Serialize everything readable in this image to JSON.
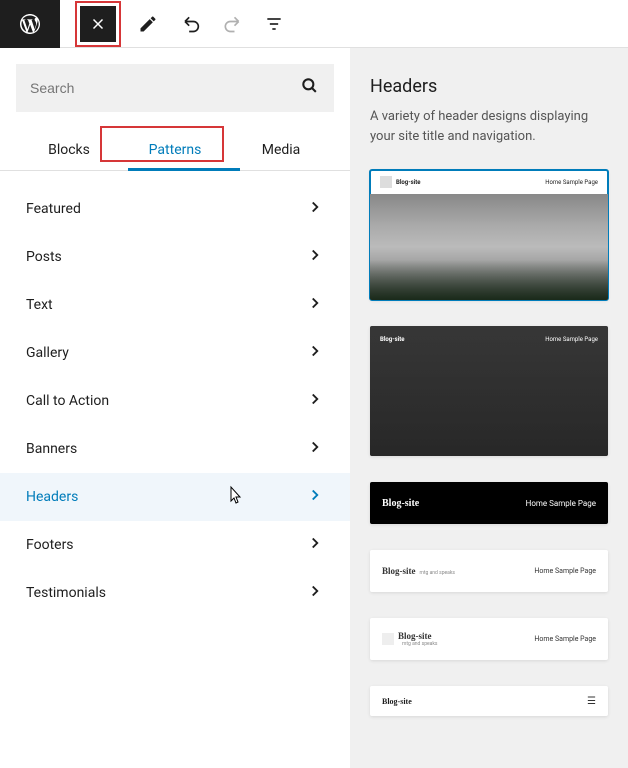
{
  "search": {
    "placeholder": "Search"
  },
  "tabs": {
    "blocks": "Blocks",
    "patterns": "Patterns",
    "media": "Media"
  },
  "categories": [
    {
      "label": "Featured",
      "active": false
    },
    {
      "label": "Posts",
      "active": false
    },
    {
      "label": "Text",
      "active": false
    },
    {
      "label": "Gallery",
      "active": false
    },
    {
      "label": "Call to Action",
      "active": false
    },
    {
      "label": "Banners",
      "active": false
    },
    {
      "label": "Headers",
      "active": true
    },
    {
      "label": "Footers",
      "active": false
    },
    {
      "label": "Testimonials",
      "active": false
    }
  ],
  "rightPanel": {
    "title": "Headers",
    "description": "A variety of header designs displaying your site title and navigation."
  },
  "previews": {
    "siteTitle": "Blog-site",
    "nav": "Home   Sample Page",
    "tagline": "mtg and speaks"
  }
}
